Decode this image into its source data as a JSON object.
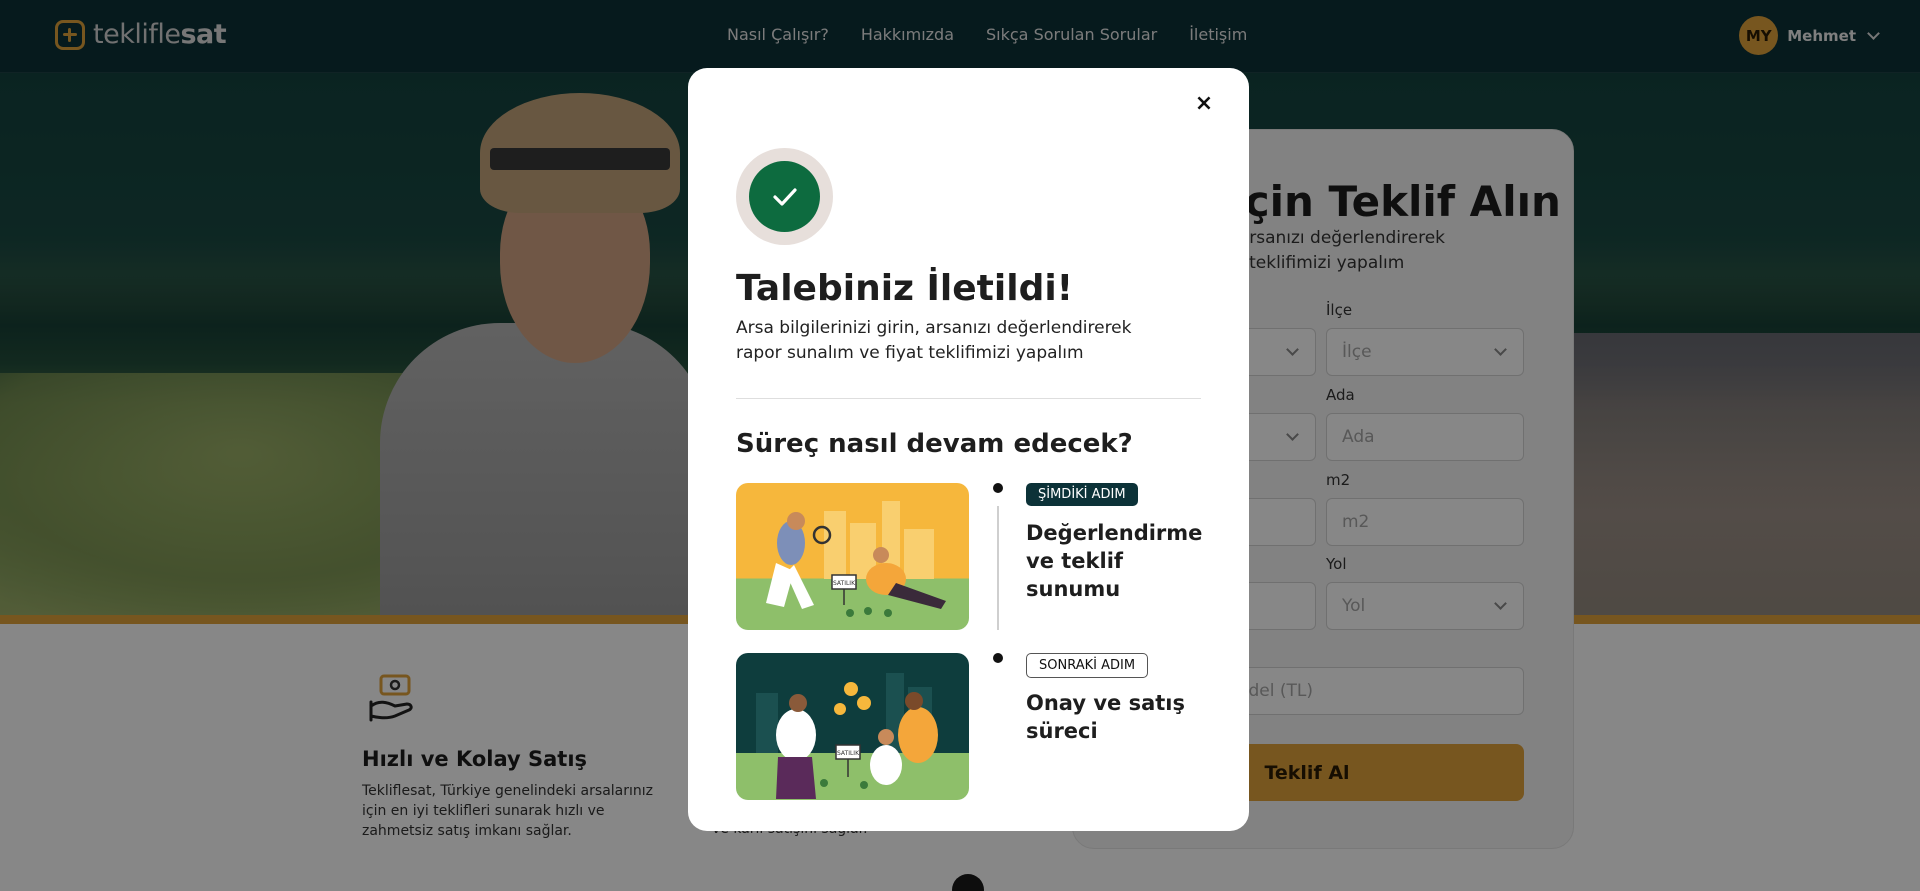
{
  "header": {
    "logo_prefix": "tekliflе",
    "logo_bold": "sat",
    "nav": [
      "Nasıl Çalışır?",
      "Hakkımızda",
      "Sıkça Sorulan Sorular",
      "İletişim"
    ],
    "user": {
      "initials": "MY",
      "name": "Mehmet"
    }
  },
  "form": {
    "title_visible": "z İçin Teklif Alın",
    "subtitle_line1": "girin, arsanızı değerlendirerek",
    "subtitle_line2": "e fiyat teklifimizi yapalım",
    "fields": {
      "ilce_label": "İlçe",
      "ilce_placeholder": "İlçe",
      "ada_label": "Ada",
      "ada_placeholder": "Ada",
      "m2_label": "m2",
      "m2_placeholder": "m2",
      "yol_label": "Yol",
      "yol_placeholder": "Yol",
      "bedel_placeholder": "edel (TL)"
    },
    "submit_label": "Teklif Al"
  },
  "features": [
    {
      "title": "Hızlı ve Kolay Satış",
      "description": "Tekliflesat, Türkiye genelindeki arsalarınız için en iyi teklifleri sunarak hızlı ve zahmetsiz satış imkanı sağlar."
    }
  ],
  "feature2_partial": "ve karlı satışını sağlar.",
  "modal": {
    "close_symbol": "×",
    "title": "Talebiniz İletildi!",
    "description": "Arsa bilgilerinizi girin, arsanızı değerlendirerek rapor sunalım ve fiyat teklifimizi yapalım",
    "process_title": "Süreç nasıl devam edecek?",
    "steps": [
      {
        "badge": "ŞİMDİKİ ADIM",
        "title": "Değerlendirme ve teklif sunumu",
        "sign_text": "SATILIK"
      },
      {
        "badge": "SONRAKİ ADIM",
        "title": "Onay ve satış süreci",
        "sign_text": "SATILIK"
      }
    ]
  },
  "colors": {
    "header_bg": "#0c3238",
    "accent": "#e0a23c",
    "success_green": "#0d6b3f",
    "overlay": "rgba(0,0,0,0.47)"
  }
}
